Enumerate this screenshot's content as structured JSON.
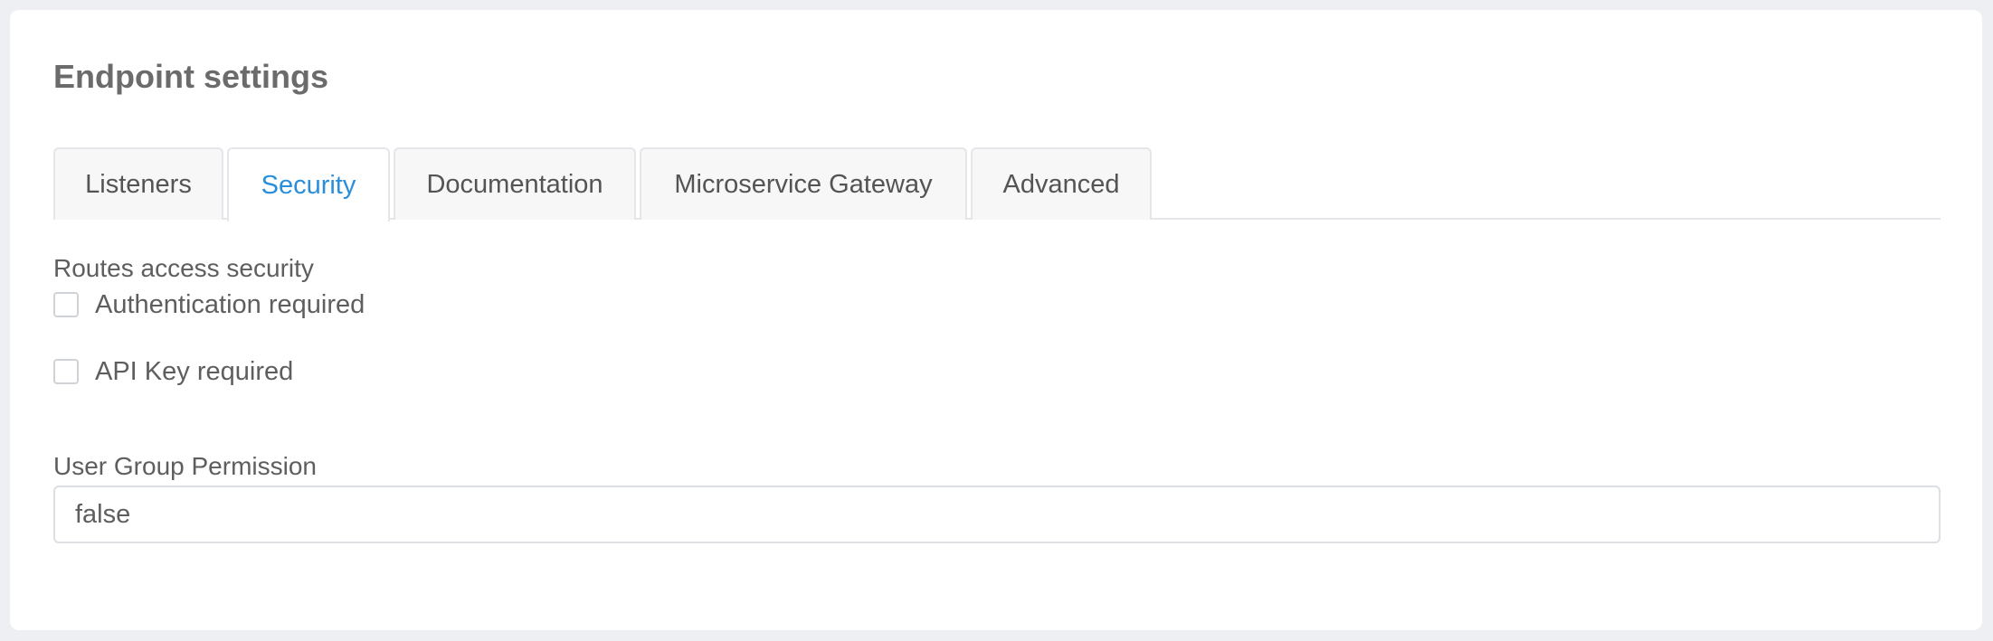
{
  "page": {
    "title": "Endpoint settings"
  },
  "tabs": [
    {
      "label": "Listeners",
      "active": false
    },
    {
      "label": "Security",
      "active": true
    },
    {
      "label": "Documentation",
      "active": false
    },
    {
      "label": "Microservice Gateway",
      "active": false
    },
    {
      "label": "Advanced",
      "active": false
    }
  ],
  "security": {
    "section_label": "Routes access security",
    "options": [
      {
        "label": "Authentication required",
        "checked": false
      },
      {
        "label": "API Key required",
        "checked": false
      }
    ]
  },
  "user_group_permission": {
    "label": "User Group Permission",
    "value": "false"
  },
  "colors": {
    "accent": "#2a8fdb",
    "background": "#eeeff2",
    "card": "#ffffff",
    "text": "#5e5e5e",
    "border": "#e4e6ea"
  }
}
